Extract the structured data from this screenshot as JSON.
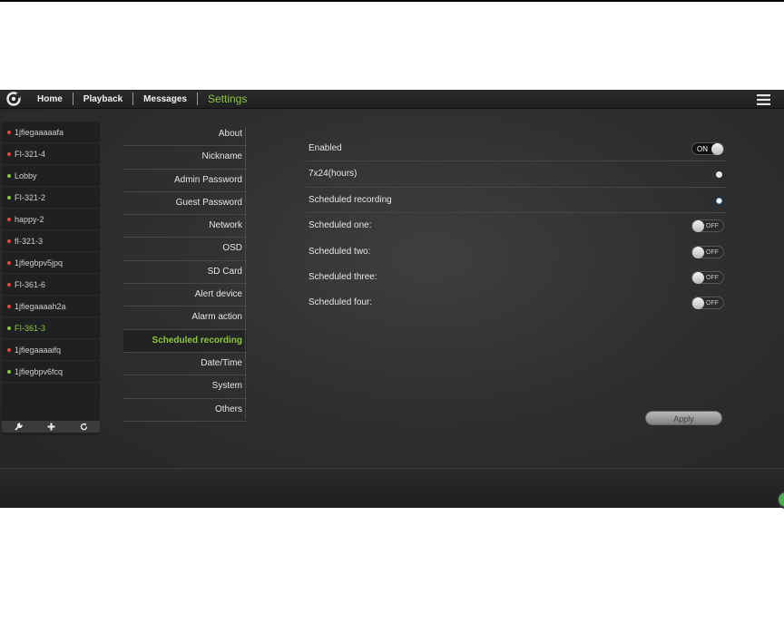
{
  "nav": {
    "home": "Home",
    "playback": "Playback",
    "messages": "Messages",
    "settings": "Settings"
  },
  "devices": [
    {
      "name": "1jfiegaaaaafa",
      "status": "offline",
      "color": "#e0463b"
    },
    {
      "name": "FI-321-4",
      "status": "offline",
      "color": "#e0463b"
    },
    {
      "name": "Lobby",
      "status": "online",
      "color": "#8dc63f"
    },
    {
      "name": "FI-321-2",
      "status": "online",
      "color": "#8dc63f"
    },
    {
      "name": "happy-2",
      "status": "offline",
      "color": "#e0463b"
    },
    {
      "name": "fI-321-3",
      "status": "offline",
      "color": "#e0463b"
    },
    {
      "name": "1jfiegbpv5jpq",
      "status": "offline",
      "color": "#e0463b"
    },
    {
      "name": "FI-361-6",
      "status": "offline",
      "color": "#e0463b"
    },
    {
      "name": "1jfiegaaaah2a",
      "status": "offline",
      "color": "#e0463b"
    },
    {
      "name": "FI-361-3",
      "status": "selected",
      "color": "#8dc63f"
    },
    {
      "name": "1jfiegaaaaifq",
      "status": "offline",
      "color": "#e0463b"
    },
    {
      "name": "1jfiegbpv6fcq",
      "status": "online",
      "color": "#8dc63f"
    }
  ],
  "sidebar_tools": [
    "wrench-icon",
    "plus-icon",
    "refresh-icon"
  ],
  "menu": [
    {
      "label": "About"
    },
    {
      "label": "Nickname"
    },
    {
      "label": "Admin Password"
    },
    {
      "label": "Guest Password"
    },
    {
      "label": "Network"
    },
    {
      "label": "OSD"
    },
    {
      "label": "SD Card"
    },
    {
      "label": "Alert device"
    },
    {
      "label": "Alarm action"
    },
    {
      "label": "Scheduled recording",
      "active": true
    },
    {
      "label": "Date/Time"
    },
    {
      "label": "System"
    },
    {
      "label": "Others"
    }
  ],
  "settings": {
    "enabled": {
      "label": "Enabled",
      "state": "ON"
    },
    "mode_24": {
      "label": "7x24(hours)",
      "checked": false
    },
    "mode_scheduled": {
      "label": "Scheduled recording",
      "checked": true
    },
    "schedules": [
      {
        "label": "Scheduled one:",
        "state": "OFF"
      },
      {
        "label": "Scheduled two:",
        "state": "OFF"
      },
      {
        "label": "Scheduled three:",
        "state": "OFF"
      },
      {
        "label": "Scheduled four:",
        "state": "OFF"
      }
    ],
    "apply": "Apply"
  },
  "colors": {
    "accent": "#8dc63f",
    "offline": "#e0463b"
  }
}
